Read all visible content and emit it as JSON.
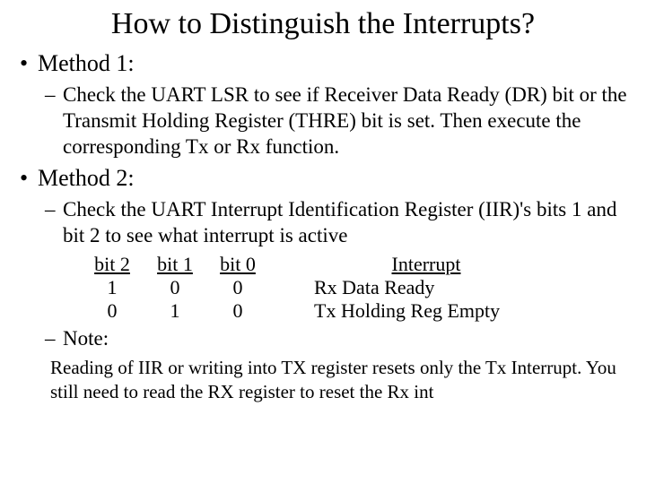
{
  "title": "How to Distinguish the Interrupts?",
  "method1": {
    "label": "Method 1:",
    "text": "Check the UART LSR to see if Receiver Data Ready (DR) bit or the Transmit Holding Register (THRE) bit is set. Then execute the corresponding Tx or Rx function."
  },
  "method2": {
    "label": "Method 2:",
    "text": "Check the UART Interrupt Identification Register (IIR)'s bits 1 and bit 2 to see what interrupt is active"
  },
  "table": {
    "headers": {
      "bit2": "bit 2",
      "bit1": "bit 1",
      "bit0": "bit 0",
      "interrupt": "Interrupt"
    },
    "rows": [
      {
        "bit2": "1",
        "bit1": "0",
        "bit0": "0",
        "interrupt": "Rx Data Ready"
      },
      {
        "bit2": "0",
        "bit1": "1",
        "bit0": "0",
        "interrupt": "Tx Holding Reg Empty"
      }
    ]
  },
  "note": {
    "label": "Note:",
    "text": "Reading of IIR or writing into TX register resets only the Tx Interrupt. You still need to read the RX register to reset the Rx int"
  }
}
